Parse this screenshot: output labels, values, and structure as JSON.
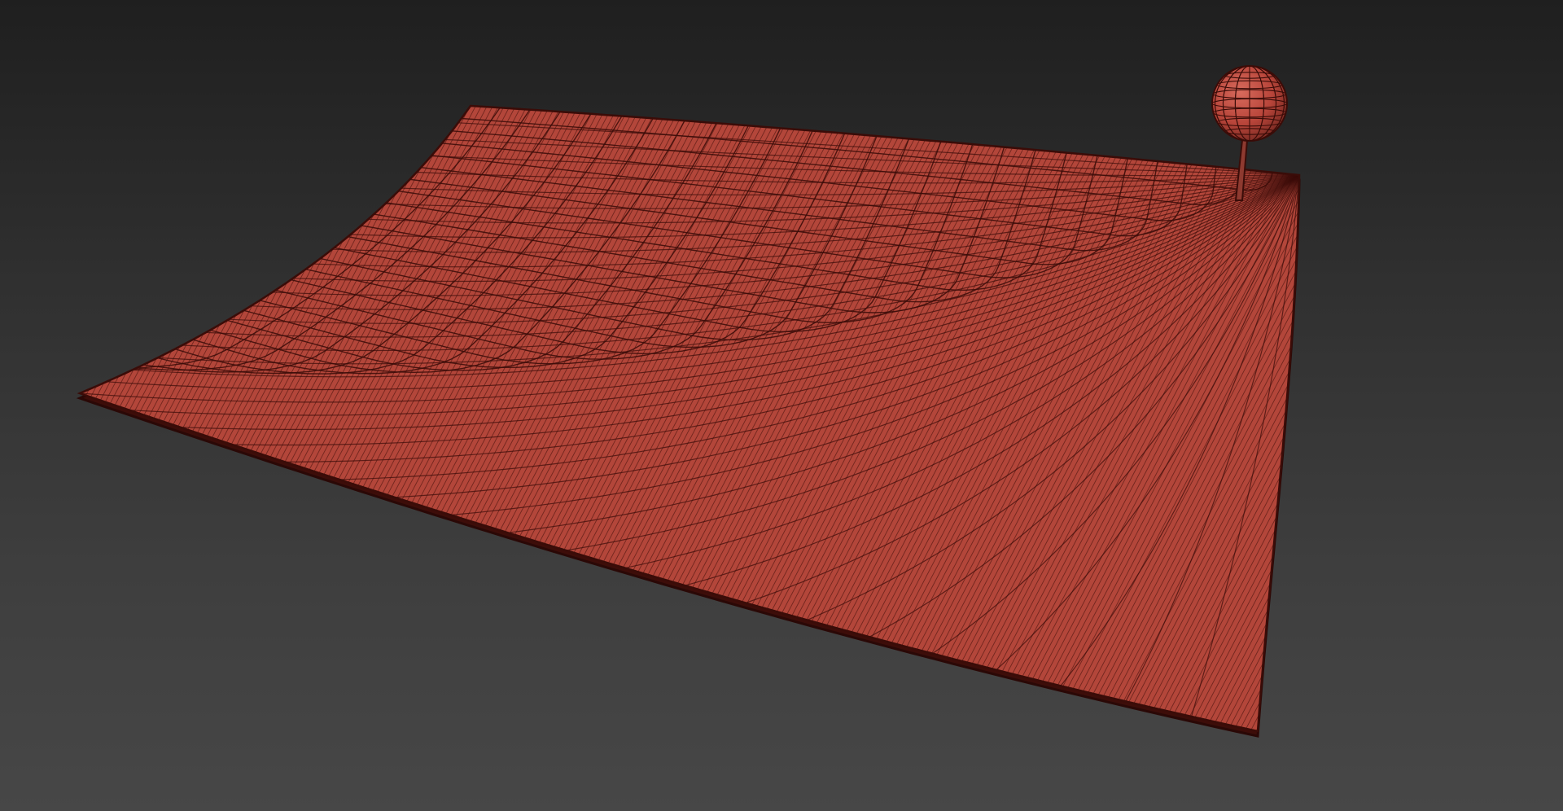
{
  "viewport": {
    "background_top": "#1f1f1f",
    "background_bottom": "#474747"
  },
  "scene_objects": [
    {
      "name": "cloth-plane",
      "kind": "wireframe-mesh",
      "color": "#b3463a",
      "wire_color": "#3a0c08"
    },
    {
      "name": "pin-sphere",
      "kind": "sphere-mesh",
      "color": "#b8453a",
      "wire_color": "#3a0c08"
    },
    {
      "name": "pin-stem",
      "kind": "cylinder",
      "color": "#8e3a30"
    }
  ]
}
